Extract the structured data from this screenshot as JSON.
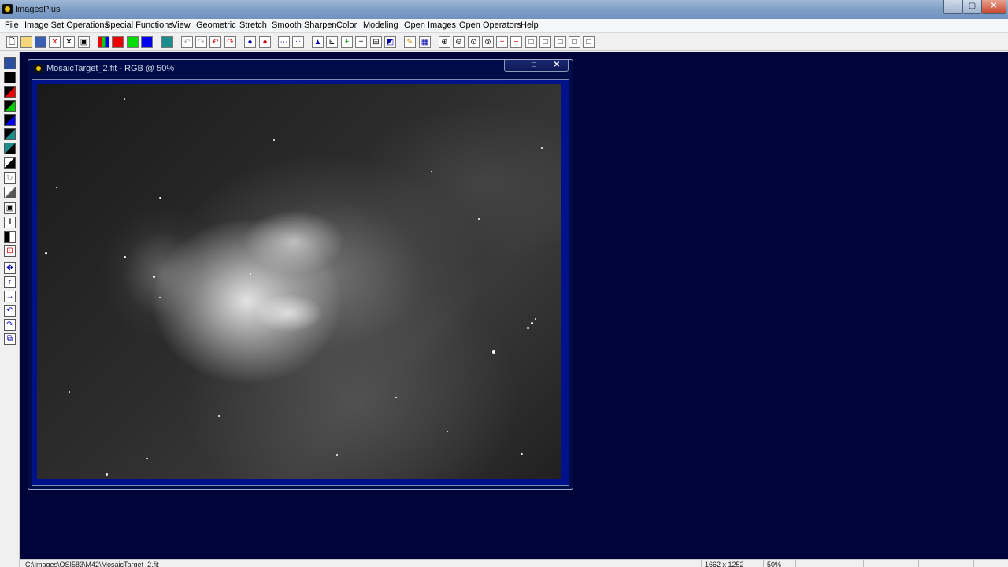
{
  "window": {
    "title": "ImagesPlus",
    "controls": {
      "min": "–",
      "max": "▢",
      "close": "✕"
    }
  },
  "menu": [
    "File",
    "Image Set Operations",
    "Special Functions",
    "View",
    "Geometric",
    "Stretch",
    "Smooth Sharpen",
    "Color",
    "Modeling",
    "Open Images",
    "Open Operators",
    "Help"
  ],
  "child_window": {
    "title": "MosaicTarget_2.fit - RGB @ 50%",
    "controls": {
      "min": "–",
      "max": "□",
      "close": "✕"
    }
  },
  "status": {
    "path": "C:\\Images\\QSI583\\M42\\MosaicTarget_2.fit",
    "dimensions": "1662 x 1252",
    "zoom": "50%"
  },
  "colors": {
    "workspace": "#000438",
    "frame": "#00128a"
  }
}
